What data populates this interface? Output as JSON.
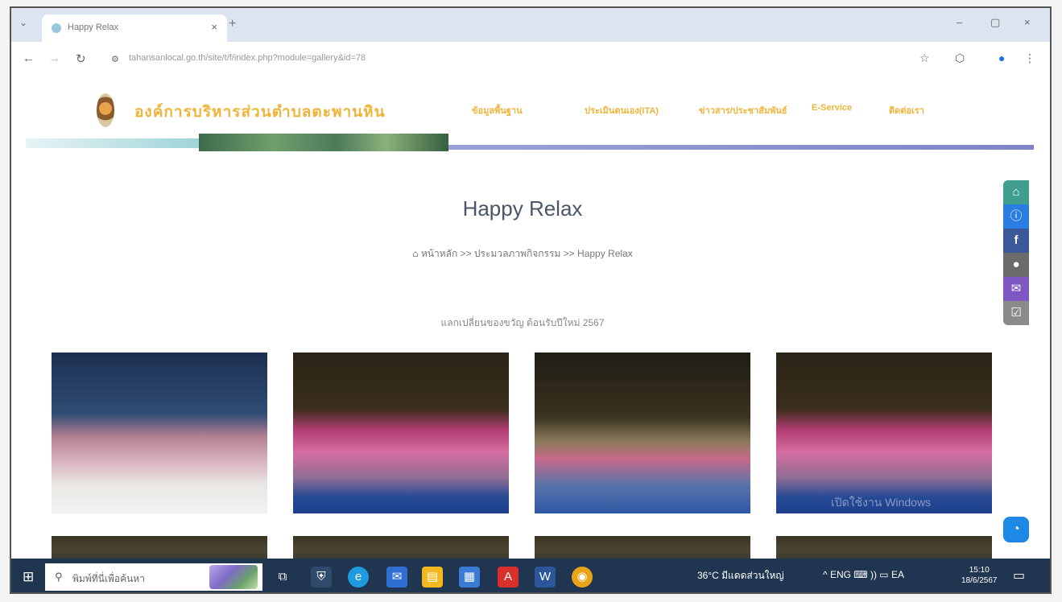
{
  "browser": {
    "tab_title": "Happy Relax",
    "new_tab": "+",
    "tab_close": "×",
    "address": "tahansanlocal.go.th/site/t/f/index.php?module=gallery&id=78",
    "win_min": "–",
    "win_max": "▢",
    "win_close": "×"
  },
  "site": {
    "org_name": "องค์การบริหารส่วนตำบลตะพานหิน",
    "menu": [
      "ข้อมูลพื้นฐาน",
      "ประเมินตนเอง(ITA)",
      "ข่าวสาร/ประชาสัมพันธ์",
      "E-Service",
      "ติดต่อเรา"
    ]
  },
  "page": {
    "title": "Happy Relax",
    "breadcrumb": "หน้าหลัก >> ประมวลภาพกิจกรรม >> Happy Relax",
    "album_title": "แลกเปลี่ยนของขวัญ ต้อนรับปีใหม่ 2567",
    "watermark": "เปิดใช้งาน Windows"
  },
  "side_buttons": [
    {
      "icon": "home-icon",
      "glyph": "⌂",
      "color": "#3f9e8e"
    },
    {
      "icon": "info-icon",
      "glyph": "ⓘ",
      "color": "#2a7de1"
    },
    {
      "icon": "facebook-icon",
      "glyph": "f",
      "color": "#3b5998"
    },
    {
      "icon": "user-icon",
      "glyph": "●",
      "color": "#6b6b6b"
    },
    {
      "icon": "mail-icon",
      "glyph": "✉",
      "color": "#7e57c2"
    },
    {
      "icon": "checklist-icon",
      "glyph": "☑",
      "color": "#8a8a8a"
    }
  ],
  "taskbar": {
    "search_placeholder": "พิมพ์ที่นี่เพื่อค้นหา",
    "weather": "36°C มีแดดส่วนใหญ่",
    "tray": "^  ENG  ⌨  ))  ▭  EA",
    "time": "15:10",
    "date": "18/6/2567"
  }
}
